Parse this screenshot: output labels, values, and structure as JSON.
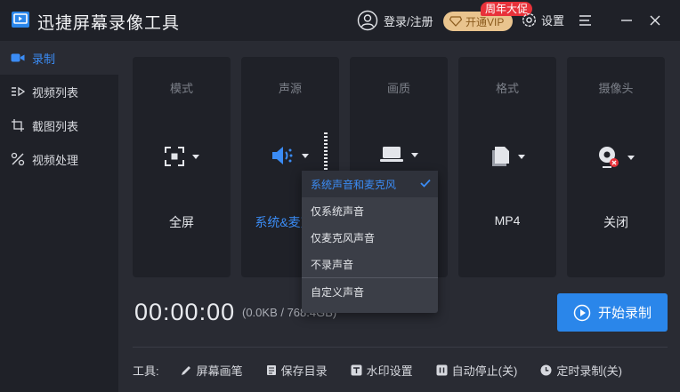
{
  "app": {
    "title": "迅捷屏幕录像工具"
  },
  "header": {
    "login": "登录/注册",
    "vip": "开通VIP",
    "promo": "周年大促",
    "settings": "设置"
  },
  "sidebar": {
    "items": [
      {
        "label": "录制",
        "icon": "camera-icon",
        "active": true
      },
      {
        "label": "视频列表",
        "icon": "video-list-icon"
      },
      {
        "label": "截图列表",
        "icon": "screenshot-icon"
      },
      {
        "label": "视频处理",
        "icon": "tools-icon"
      }
    ]
  },
  "cards": [
    {
      "title": "模式",
      "value": "全屏",
      "icon": "fullscreen-icon"
    },
    {
      "title": "声源",
      "value": "系统&麦克风",
      "icon": "speaker-icon"
    },
    {
      "title": "画质",
      "value": "",
      "icon": "laptop-icon"
    },
    {
      "title": "格式",
      "value": "MP4",
      "icon": "file-icon"
    },
    {
      "title": "摄像头",
      "value": "关闭",
      "icon": "webcam-icon"
    }
  ],
  "recording": {
    "timer": "00:00:00",
    "size": "(0.0KB / 768.4GB)",
    "start": "开始录制"
  },
  "tools": {
    "label": "工具:",
    "items": [
      "屏幕画笔",
      "保存目录",
      "水印设置",
      "自动停止(关)",
      "定时录制(关)"
    ]
  },
  "audio_dropdown": {
    "options": [
      "系统声音和麦克风",
      "仅系统声音",
      "仅麦克风声音",
      "不录声音",
      "自定义声音"
    ],
    "selected": "系统声音和麦克风"
  },
  "colors": {
    "accent": "#2a86ea",
    "panel": "#1f2128",
    "bg": "#292b33",
    "promo": "#e8323a",
    "vip": "#e9c48e"
  }
}
